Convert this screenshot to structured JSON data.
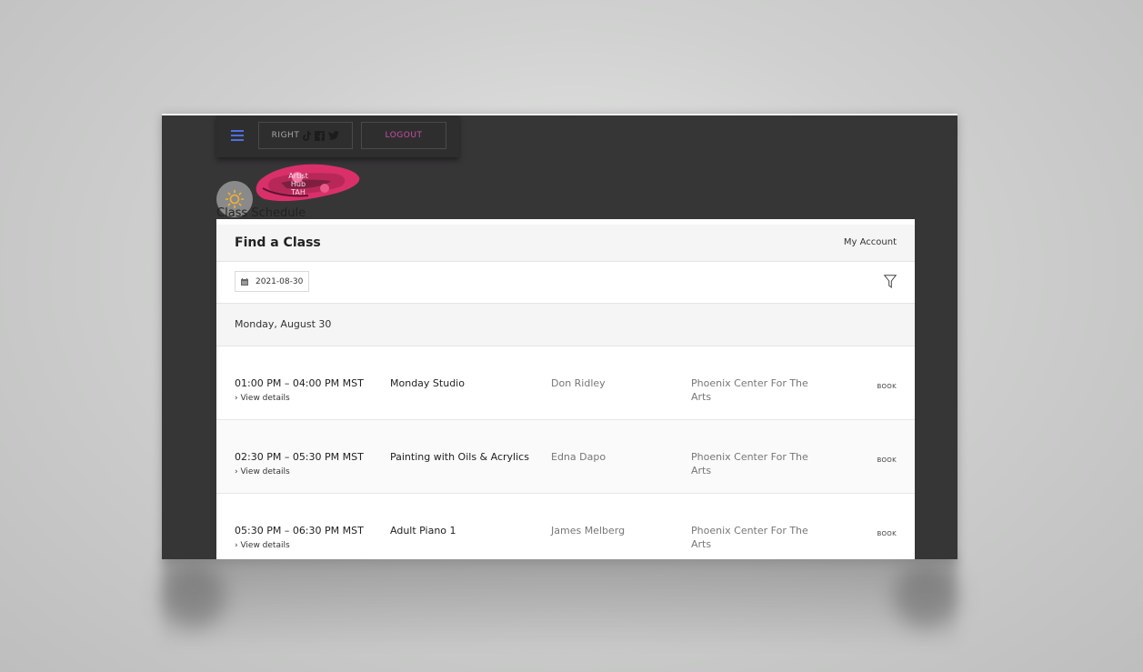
{
  "header": {
    "menu_icon": "hamburger-menu-icon",
    "right_button_label": "RIGHT",
    "social_icons": [
      "tiktok-icon",
      "facebook-icon",
      "twitter-icon"
    ],
    "logout_label": "LOGOUT",
    "theme_icon": "sun-icon",
    "logo_text_line1": "Artist Hub",
    "logo_text_line2": "TAH"
  },
  "schedule": {
    "section_label": "Class Schedule",
    "title": "Find a Class",
    "my_account": "My Account",
    "date_value": "2021-08-30",
    "calendar_icon": "calendar-icon",
    "filter_icon": "filter-icon",
    "day_heading": "Monday, August 30",
    "classes": [
      {
        "time": "01:00 PM – 04:00 PM MST",
        "details": "› View details",
        "name": "Monday Studio",
        "teacher": "Don Ridley",
        "location": "Phoenix Center For The Arts",
        "action": "BOOK"
      },
      {
        "time": "02:30 PM – 05:30 PM MST",
        "details": "› View details",
        "name": "Painting with Oils & Acrylics",
        "teacher": "Edna Dapo",
        "location": "Phoenix Center For The Arts",
        "action": "BOOK"
      },
      {
        "time": "05:30 PM – 06:30 PM MST",
        "details": "› View details",
        "name": "Adult Piano 1",
        "teacher": "James Melberg",
        "location": "Phoenix Center For The Arts",
        "action": "BOOK"
      }
    ]
  },
  "colors": {
    "window_bg": "#373637",
    "logout_text": "#c84fa8",
    "menu_accent": "#4f6fe0",
    "sun_icon": "#f2b233"
  }
}
